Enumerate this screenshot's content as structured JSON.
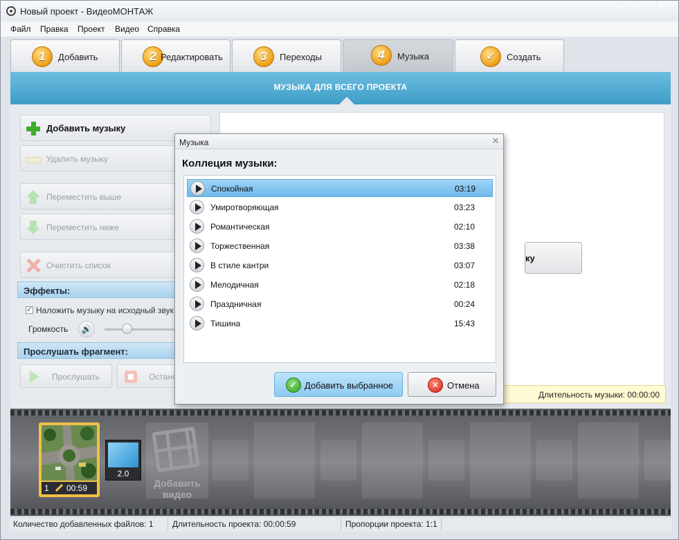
{
  "window": {
    "title": "Новый проект - ВидеоМОНТАЖ"
  },
  "menu": [
    "Файл",
    "Правка",
    "Проект",
    "Видео",
    "Справка"
  ],
  "tabs": [
    {
      "num": "1",
      "label": "Добавить"
    },
    {
      "num": "2",
      "label": "Редактировать"
    },
    {
      "num": "3",
      "label": "Переходы"
    },
    {
      "num": "4",
      "label": "Музыка"
    },
    {
      "num": "",
      "label": "Создать"
    }
  ],
  "banner": {
    "title": "МУЗЫКА ДЛЯ ВСЕГО ПРОЕКТА"
  },
  "left_panel": {
    "add_music": "Добавить музыку",
    "remove_music": "Удалить музыку",
    "move_up": "Переместить выше",
    "move_down": "Переместить ниже",
    "clear_list": "Очистить список",
    "effects_header": "Эффекты:",
    "overlay_checkbox": "Наложить музыку на исходный звук",
    "volume_label": "Громкость",
    "preview_header": "Прослушать фрагмент:",
    "listen": "Прослушать",
    "stop": "Остановить"
  },
  "right_panel": {
    "add_button_partial": "ку",
    "music_duration": "Длительность музыки: 00:00:00"
  },
  "timeline": {
    "clip": {
      "index": "1",
      "duration": "00:59"
    },
    "transition": {
      "value": "2.0"
    },
    "add_video": "Добавить видео"
  },
  "statusbar": {
    "files": "Количество добавленных файлов: 1",
    "duration": "Длительность проекта:  00:00:59",
    "ratio": "Пропорции проекта:  1:1"
  },
  "dialog": {
    "title": "Музыка",
    "heading": "Коллеция музыки:",
    "tracks": [
      {
        "name": "Спокойная",
        "duration": "03:19"
      },
      {
        "name": "Умиротворяющая",
        "duration": "03:23"
      },
      {
        "name": "Романтическая",
        "duration": "02:10"
      },
      {
        "name": "Торжественная",
        "duration": "03:38"
      },
      {
        "name": "В стиле кантри",
        "duration": "03:07"
      },
      {
        "name": "Мелодичная",
        "duration": "02:18"
      },
      {
        "name": "Праздничная",
        "duration": "00:24"
      },
      {
        "name": "Тишина",
        "duration": "15:43"
      }
    ],
    "selected_index": 0,
    "add_selected": "Добавить выбранное",
    "cancel": "Отмена"
  },
  "colors": {
    "accent": "#4aa7d0",
    "tab_badge": "#f0a21c",
    "selection": "#8fcaf2",
    "clip_border": "#f1c048"
  }
}
